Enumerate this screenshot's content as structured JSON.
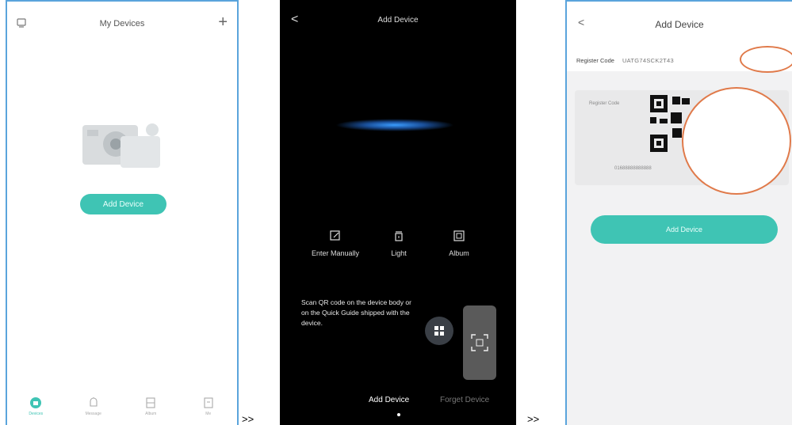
{
  "separator": ">>",
  "screen1": {
    "title": "My Devices",
    "add_icon": "+",
    "add_button": "Add Device",
    "tabs": [
      {
        "icon": "home-icon",
        "label": "Devices",
        "active": true
      },
      {
        "icon": "message-icon",
        "label": "Message",
        "active": false
      },
      {
        "icon": "album-icon",
        "label": "Album",
        "active": false
      },
      {
        "icon": "me-icon",
        "label": "Me",
        "active": false
      }
    ]
  },
  "screen2": {
    "back": "<",
    "title": "Add Device",
    "options": [
      {
        "icon": "edit-icon",
        "label": "Enter Manually"
      },
      {
        "icon": "light-icon",
        "label": "Light"
      },
      {
        "icon": "album-icon",
        "label": "Album"
      }
    ],
    "hint": "Scan QR code on the device body or on the Quick Guide shipped with the device.",
    "tabs": [
      "Add Device",
      "Forget Device"
    ]
  },
  "screen3": {
    "back": "<",
    "title": "Add Device",
    "register_label": "Register Code",
    "register_value": "UATG74SCK2T43",
    "panel_label": "Register Code",
    "serial": "01688888888888",
    "button": "Add Device"
  },
  "colors": {
    "accent": "#3fc4b4",
    "frame": "#5aa4dc",
    "highlight": "#e07a4a"
  }
}
